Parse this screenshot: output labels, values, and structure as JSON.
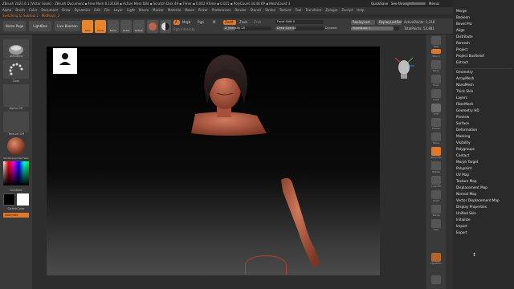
{
  "app": {
    "title": "ZBrush 2022.0.1 [Victor Seals] · ZBrush Document ▪ Free Mem 8.131GB ▪ Active Mem 684 ▪ Scratch Disk 49 ▪ Timer ▪ 0.002 ATime ▪ 0.021 ▪ PolyCount 34.46 KP ▪ MeshCount 3",
    "quicksave": "QuickSave",
    "see_through": "See-through 0",
    "menus_label": "Menus",
    "default_script": "DefaultZScript"
  },
  "menubar": [
    "Alpha",
    "Brush",
    "Color",
    "Document",
    "Draw",
    "Dynamics",
    "Edit",
    "File",
    "Layer",
    "Light",
    "Macro",
    "Marker",
    "Material",
    "Movie",
    "Picker",
    "Preferences",
    "Render",
    "Stencil",
    "Stroke",
    "Texture",
    "Tool",
    "Transform",
    "Zplugin",
    "Zscript",
    "Help"
  ],
  "subbar": {
    "switching": "Switching to Subtool 2 · MidPoly2_2"
  },
  "toolbar": {
    "home_page": "Home Page",
    "lightbox": "LightBox",
    "live_boolean": "Live Boolean",
    "edit": "Edit",
    "draw": "Draw",
    "move": "Move",
    "scale": "Scale",
    "rotate": "Rotate",
    "a_label": "A",
    "mrgb": "Mrgb",
    "rgb": "Rgb",
    "m": "M",
    "rgb_intensity": "Rgb Intensity",
    "zadd": "Zadd",
    "zsub": "Zsub",
    "zcut": "Zcut",
    "z_intensity": "Z Intensity 25",
    "focal_shift": "Focal Shift 0",
    "draw_size": "Draw Size 64",
    "dynamic": "Dynamic",
    "replay_last": "ReplayLast",
    "replay_last_rel": "ReplayLastRel",
    "adjust_last": "AdjustLast 1",
    "active_points": "ActivePoints: 1,218",
    "total_points": "TotalPoints: 53,881"
  },
  "left_shelf": {
    "standard": "Standard",
    "dots": "Dots",
    "alpha_off": "Alpha Off",
    "texture_off": "Texture Off",
    "material": "SkinShade4 Red Wax",
    "gradient": "Gradient",
    "switch_color": "SwitchColor",
    "alternate": "Alternate"
  },
  "right_shelf": {
    "bpr": "BPR",
    "spix": "SPix 3",
    "persp": "Persp",
    "floor": "Floor",
    "local": "Local",
    "xyz": "XYZ",
    "frame": "Frame",
    "move": "Move",
    "zoom3d": "Zoom3D",
    "rotate": "Rotate",
    "line_fill": "Line Fill",
    "polyf": "PolyF",
    "transp": "Transp",
    "solo": "Solo",
    "dynamic": "Dynamic"
  },
  "palette": {
    "top_items": [
      "Merge",
      "Boolean",
      "Bevel Pro",
      "Align",
      "Distribute",
      "Remesh",
      "Project",
      "Project BasRelief",
      "Extract"
    ],
    "items": [
      "Geometry",
      "ArrayMesh",
      "NanoMesh",
      "Thick Skin",
      "Layers",
      "FiberMesh",
      "Geometry HD",
      "Preview",
      "Surface",
      "Deformation",
      "Masking",
      "Visibility",
      "Polygroups",
      "Contact",
      "Morph Target",
      "Polypaint",
      "UV Map",
      "Texture Map",
      "Displacement Map",
      "Normal Map",
      "Vector Displacement Map",
      "Display Properties",
      "Unified Skin",
      "Initialize",
      "Import",
      "Export"
    ]
  },
  "colors": {
    "accent": "#e8852c",
    "skin": "#c0624a",
    "background": "#303030"
  }
}
